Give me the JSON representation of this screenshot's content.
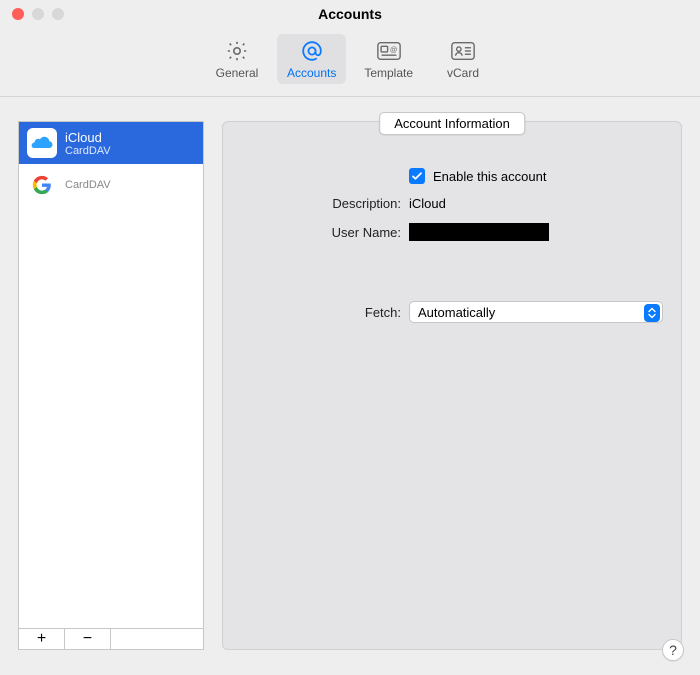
{
  "window": {
    "title": "Accounts"
  },
  "toolbar": {
    "items": [
      {
        "id": "general",
        "label": "General"
      },
      {
        "id": "accounts",
        "label": "Accounts"
      },
      {
        "id": "template",
        "label": "Template"
      },
      {
        "id": "vcard",
        "label": "vCard"
      }
    ],
    "selected": "accounts"
  },
  "sidebar": {
    "accounts": [
      {
        "name": "iCloud",
        "subtype": "CardDAV",
        "selected": true,
        "icon": "icloud"
      },
      {
        "name": "████████",
        "subtype": "CardDAV",
        "selected": false,
        "icon": "google",
        "redacted": true
      }
    ],
    "add_label": "+",
    "remove_label": "−"
  },
  "detail": {
    "section_title": "Account Information",
    "enable_label": "Enable this account",
    "enable_checked": true,
    "description_label": "Description:",
    "description_value": "iCloud",
    "username_label": "User Name:",
    "username_value": "████████",
    "fetch_label": "Fetch:",
    "fetch_value": "Automatically"
  },
  "help": "?"
}
